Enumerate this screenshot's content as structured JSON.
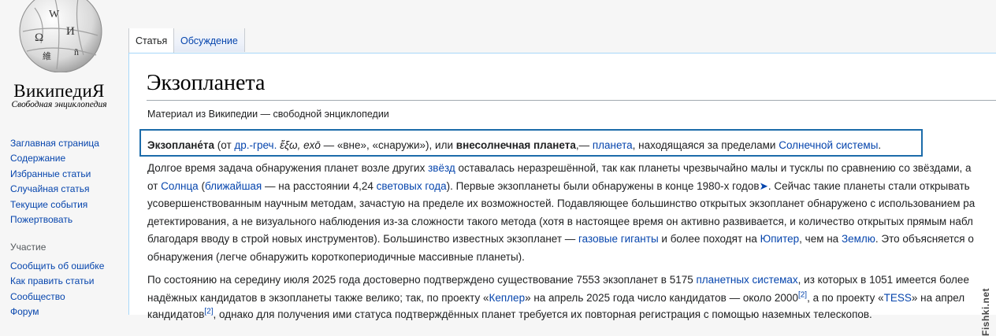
{
  "logo": {
    "wordmark": "ВикипедиЯ",
    "tagline": "Свободная энциклопедия",
    "glyphs": [
      "W",
      "Ω",
      "И",
      "維",
      "ñ"
    ]
  },
  "sidebar": {
    "nav": [
      "Заглавная страница",
      "Содержание",
      "Избранные статьи",
      "Случайная статья",
      "Текущие события",
      "Пожертвовать"
    ],
    "section_heading": "Участие",
    "participation": [
      "Сообщить об ошибке",
      "Как править статьи",
      "Сообщество",
      "Форум"
    ]
  },
  "tabs": {
    "article": "Статья",
    "talk": "Обсуждение"
  },
  "article": {
    "title": "Экзопланета",
    "subtitle": "Материал из Википедии — свободной энциклопедии",
    "lead": {
      "term": "Экзоплане́та",
      "t1": " (от ",
      "lang_link": "др.-греч.",
      "greek": " ἔξω, exō",
      "t2": " — «вне», «снаружи»), или ",
      "alt_term": "внесолнечная планета",
      "t3": ",— ",
      "planet_link": "планета",
      "t4": ", находящаяся за пределами ",
      "solar_link": "Солнечной системы"
    },
    "p1": {
      "l1a": "Долгое время задача обнаружения планет возле других ",
      "l1_link": "звёзд",
      "l1b": " оставалась неразрешённой, так как планеты чрезвычайно малы и тусклы по сравнению со звёздами, а",
      "l2a": "от ",
      "l2_link1": "Солнца",
      "l2b": " (",
      "l2_link2": "ближайшая",
      "l2c": " — на расстоянии 4,24 ",
      "l2_link3": "световых года",
      "l2d": "). Первые экзопланеты были обнаружены в конце 1980-х годов",
      "l2_arrow": "➤",
      "l2e": ". Сейчас такие планеты стали открывать",
      "l3": "усовершенствованным научным методам, зачастую на пределе их возможностей. Подавляющее большинство открытых экзопланет обнаружено с использованием ра",
      "l4": "детектирования, а не визуального наблюдения из-за сложности такого метода (хотя в настоящее время он активно развивается, и количество открытых прямым набл",
      "l5a": "благодаря вводу в строй новых инструментов). Большинство известных экзопланет — ",
      "l5_link1": "газовые гиганты",
      "l5b": " и более походят на ",
      "l5_link2": "Юпитер",
      "l5c": ", чем на ",
      "l5_link3": "Землю",
      "l5d": ". Это объясняется о",
      "l6": "обнаружения (легче обнаружить короткопериодичные массивные планеты)."
    },
    "p2": {
      "l1a": "По состоянию на середину июля 2025 года достоверно подтверждено существование 7553 экзопланет в 5175 ",
      "l1_link": "планетных системах",
      "l1b": ", из которых в 1051 имеется более",
      "l2a": "надёжных кандидатов в экзопланеты также велико; так, по проекту «",
      "l2_link1": "Кеплер",
      "l2b": "» на апрель 2025 года число кандидатов — около 2000",
      "l2_ref1": "[2]",
      "l2c": ", а по проекту «",
      "l2_link2": "TESS",
      "l2d": "» на апрел",
      "l3a": "кандидатов",
      "l3_ref": "[2]",
      "l3b": ", однако для получения ими статуса подтверждённых планет требуется их повторная регистрация с помощью наземных телескопов."
    }
  },
  "watermark": "Fishki.net"
}
